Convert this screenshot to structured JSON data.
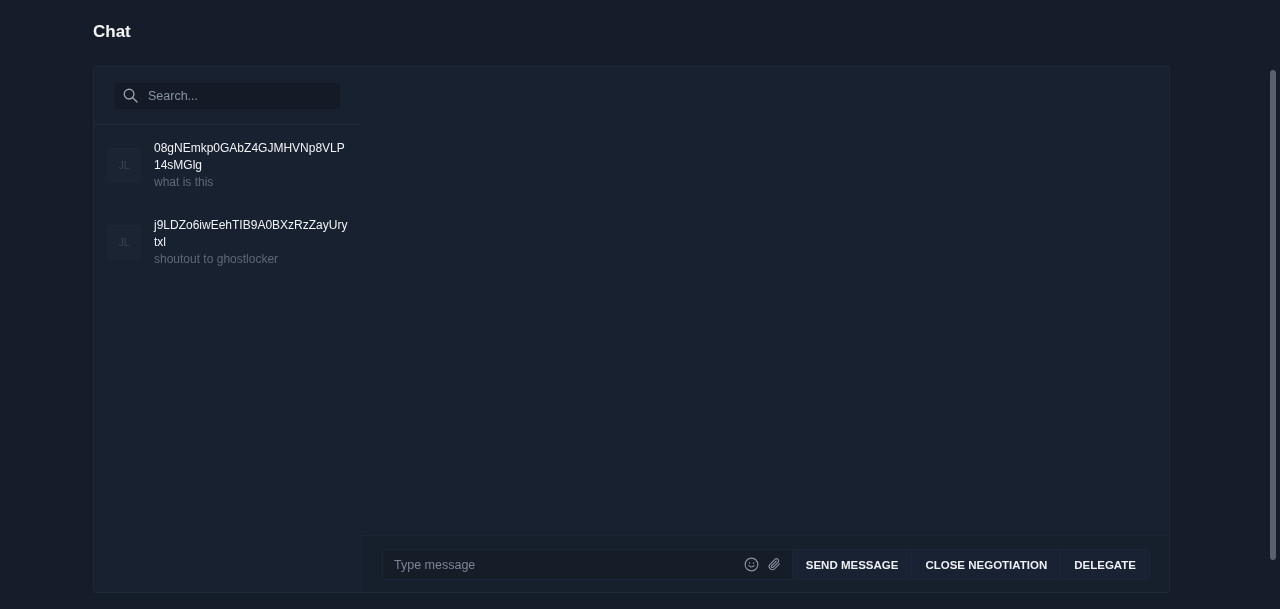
{
  "page": {
    "title": "Chat"
  },
  "search": {
    "placeholder": "Search..."
  },
  "conversations": [
    {
      "initials": "JL",
      "name": "08gNEmkp0GAbZ4GJMHVNp8VLP14sMGlg",
      "preview": "what is this",
      "selected": false
    },
    {
      "initials": "JL",
      "name": "j9LDZo6iwEehTIB9A0BXzRzZayUrytxl",
      "preview": "shoutout to ghostlocker",
      "selected": false
    }
  ],
  "composer": {
    "placeholder": "Type message"
  },
  "buttons": [
    "SEND MESSAGE",
    "CLOSE NEGOTIATION",
    "DELEGATE"
  ]
}
